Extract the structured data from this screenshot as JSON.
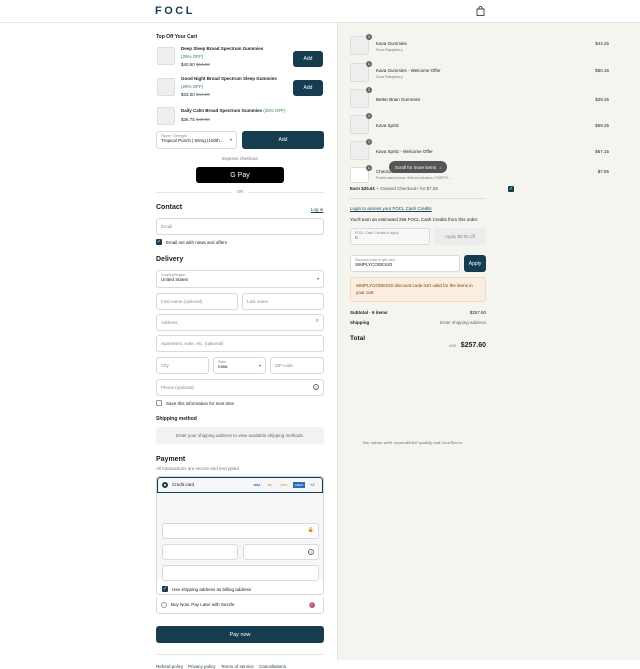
{
  "header": {
    "logo": "FOCL"
  },
  "topoff": {
    "title": "Top Off Your Cart",
    "items": [
      {
        "name": "Deep Sleep Broad Spectrum Gummies",
        "off": "(25% OFF)",
        "price": "$40.50",
        "compare": "$54.00",
        "btn": "Add"
      },
      {
        "name": "Good Night Broad Spectrum Sleep Gummies",
        "off": "(25% OFF)",
        "price": "$33.00",
        "compare": "$44.00",
        "btn": "Add"
      },
      {
        "name": "Daily Calm Broad Spectrum Gummies",
        "off": "(25% OFF)",
        "price": "$36.75",
        "compare": "$49.00"
      }
    ],
    "flavor_label": "Flavor / Strength",
    "flavor_value": "Tropical Punch | 50mg (150th...",
    "flavor_btn": "Add"
  },
  "express": {
    "label": "Express checkout",
    "gpay": "G Pay",
    "or": "OR"
  },
  "contact": {
    "title": "Contact",
    "login": "Log in",
    "email_ph": "Email",
    "news": "Email me with news and offers"
  },
  "delivery": {
    "title": "Delivery",
    "country_label": "Country/Region",
    "country": "United States",
    "first": "First name (optional)",
    "last": "Last name",
    "address": "Address",
    "apt": "Apartment, suite, etc. (optional)",
    "city": "City",
    "state_label": "State",
    "state": "Iowa",
    "zip": "ZIP code",
    "phone": "Phone (optional)",
    "save": "Save this information for next time"
  },
  "shipping": {
    "title": "Shipping method",
    "msg": "Enter your shipping address to view available shipping methods."
  },
  "payment": {
    "title": "Payment",
    "sub": "All transactions are secure and encrypted.",
    "card": "Credit card",
    "brands": [
      "VISA",
      "MC",
      "DISC",
      "AMEX"
    ],
    "more": "+2",
    "billing": "Use shipping address as billing address",
    "sezzle": "Buy Now, Pay Later with Sezzle",
    "pay": "Pay now"
  },
  "footer": {
    "links": [
      "Refund policy",
      "Privacy policy",
      "Terms of service",
      "Cancellations"
    ]
  },
  "summary": {
    "items": [
      {
        "qty": "1",
        "name": "Kava Gummies",
        "variant": "Sour Raspberry",
        "price": "$44.25"
      },
      {
        "qty": "1",
        "name": "Kava Gummies - Welcome Offer",
        "variant": "Sour Raspberry",
        "price": "$50.15"
      },
      {
        "qty": "1",
        "name": "Better Brain Gummies",
        "variant": "",
        "price": "$29.25"
      },
      {
        "qty": "1",
        "name": "Kava Spritz",
        "variant": "",
        "price": "$59.25"
      },
      {
        "qty": "1",
        "name": "Kava Spritz - Welcome Offer",
        "variant": "",
        "price": "$67.15"
      },
      {
        "qty": "1",
        "name": "Checkout+",
        "variant": "Protect android once. Shift and declares LTMSFTO...",
        "price": "$7.55"
      }
    ],
    "scroll": "Scroll for more items",
    "earn": "Earn $25.61",
    "earn_rest": "+ Onward Checkout+ for $7.55",
    "login_link": "Login to access your FOCL Cash Credits",
    "cash_msg": "You'll earn an estimated 256 FOCL Cash Credits from this order.",
    "cash_label": "FOCL Cash Credits to apply",
    "cash_val": "0",
    "cash_btn": "Apply $0.00 off",
    "disc_label": "Discount code or gift card",
    "disc_val": "SIMPLYCODES20",
    "disc_btn": "Apply",
    "error": "SIMPLYCODES20 discount code isn't valid for the items in your cart",
    "subtotal_label": "Subtotal · 6 items",
    "subtotal": "$257.60",
    "ship_label": "Shipping",
    "ship_val": "Enter shipping address",
    "total_label": "Total",
    "currency": "USD",
    "total": "$257.60",
    "tagline": "the nation with unparalleled quality and excellence."
  },
  "colors": {
    "accent": "#163d4f",
    "error_bg": "#fbeee0"
  }
}
